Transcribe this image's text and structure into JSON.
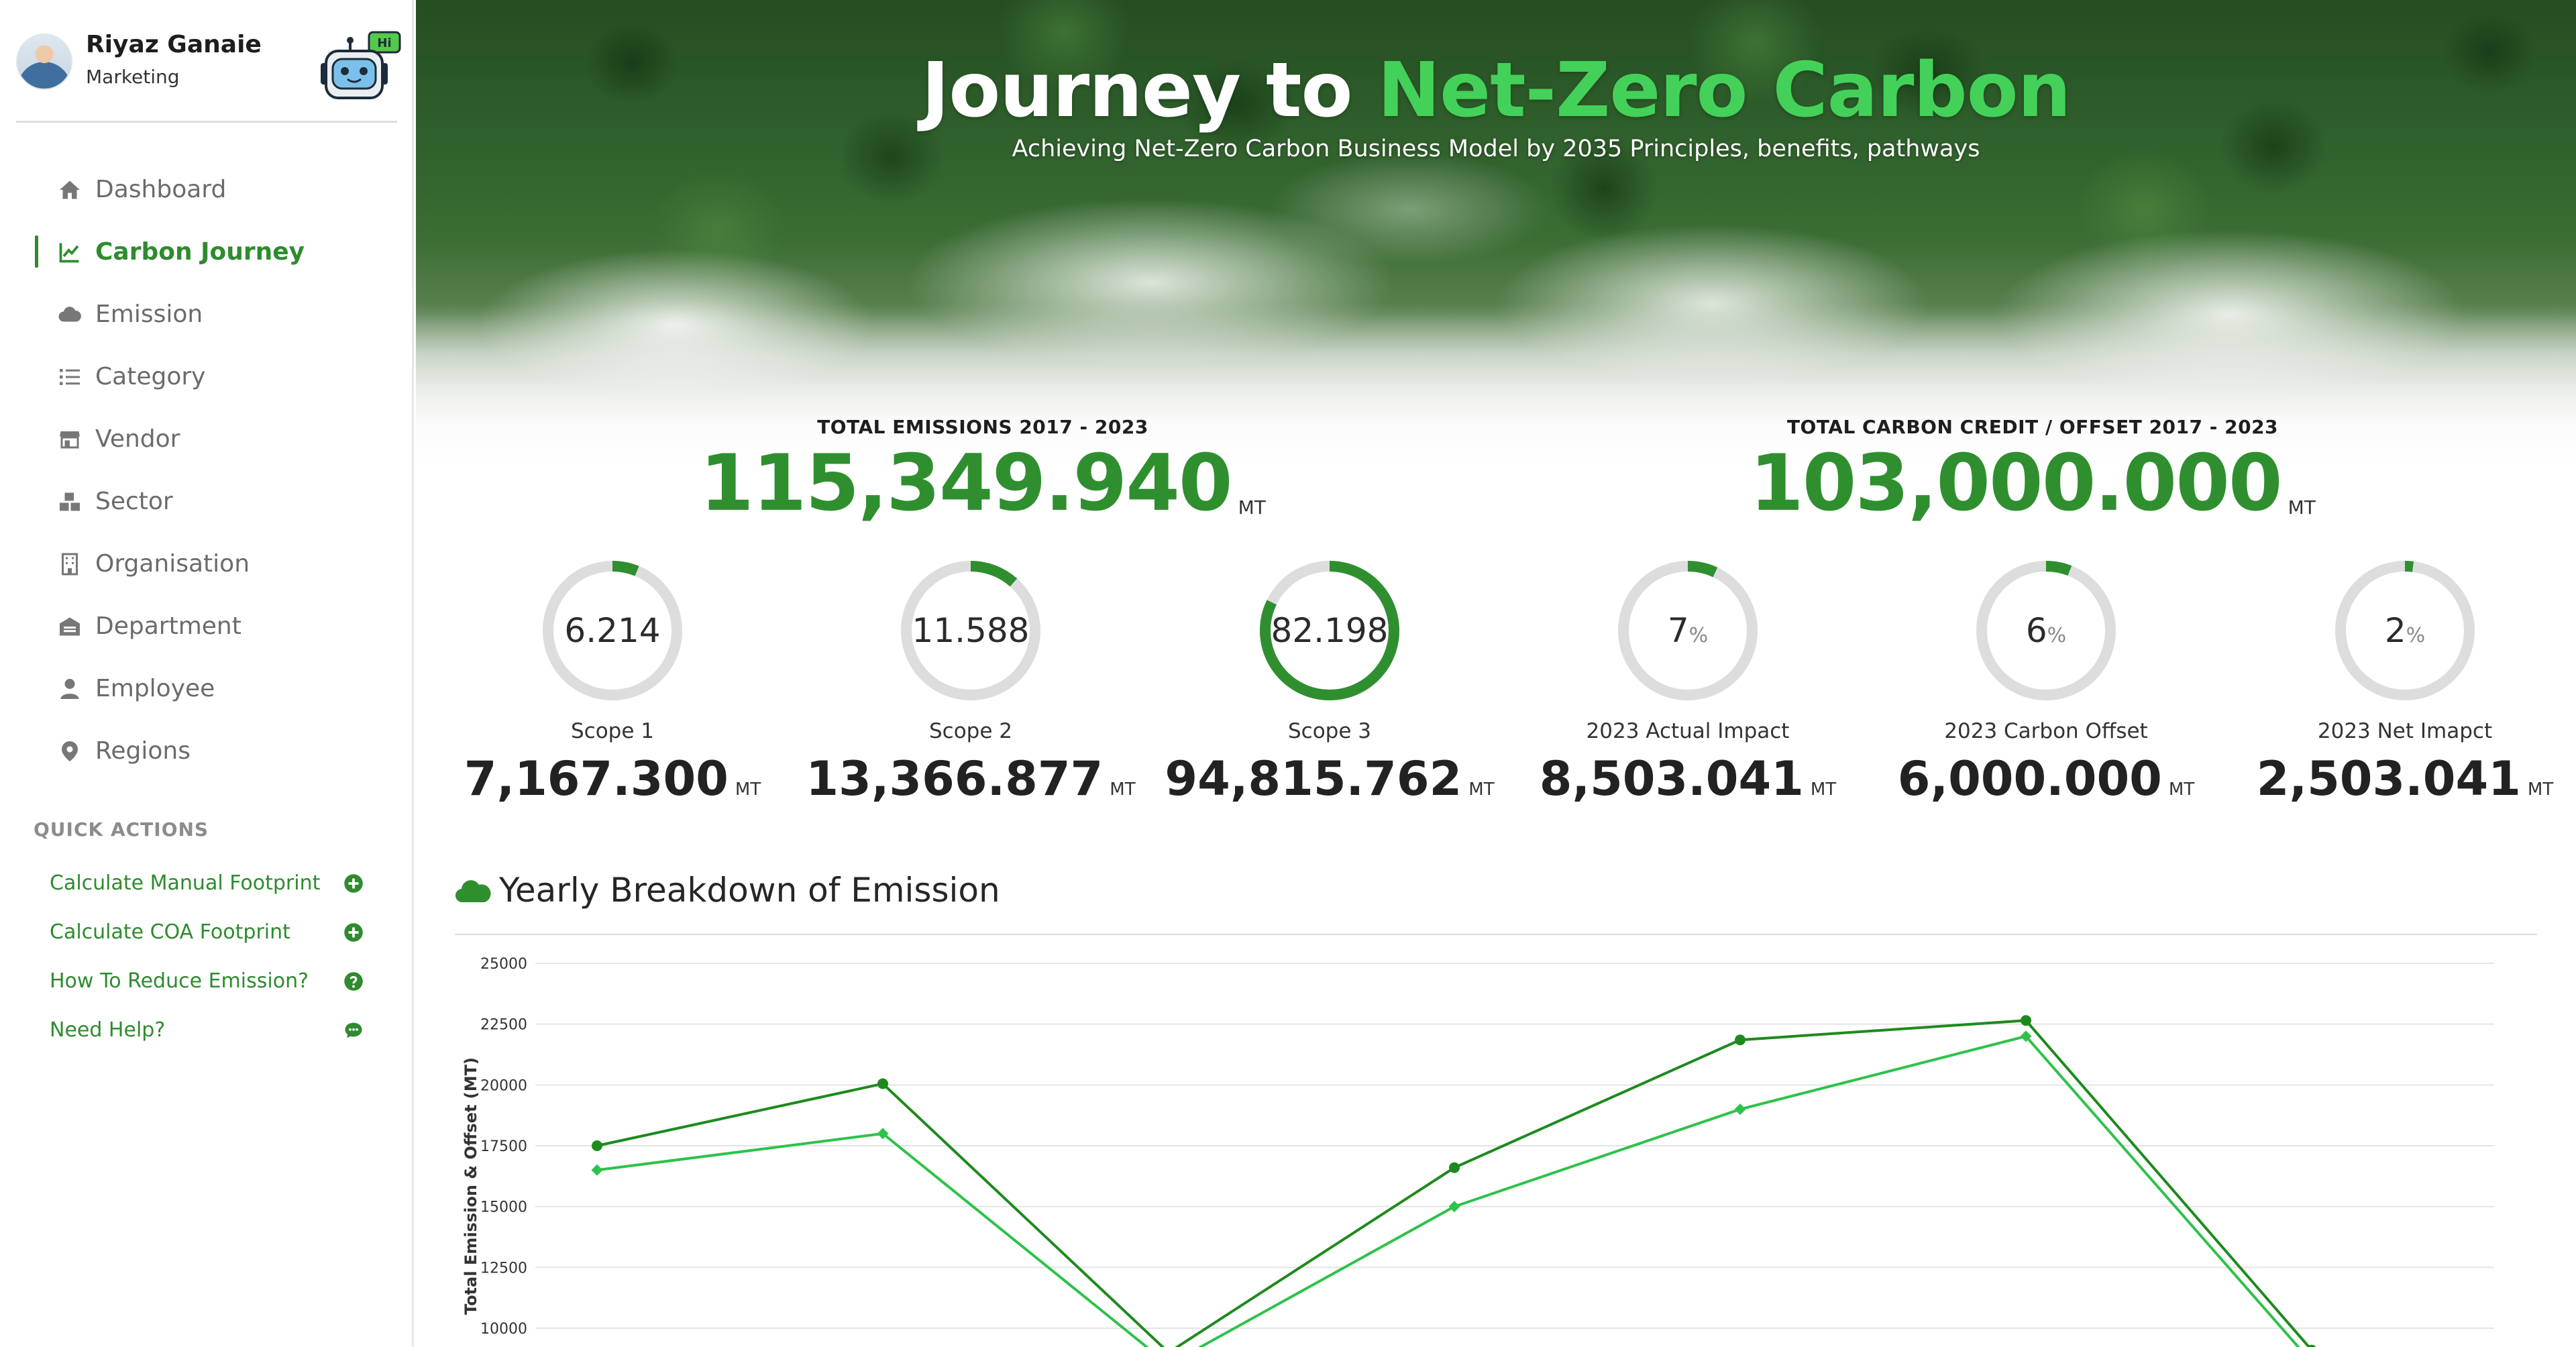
{
  "user": {
    "name": "Riyaz Ganaie",
    "role": "Marketing",
    "bot_badge": "Hi"
  },
  "nav": {
    "items": [
      {
        "label": "Dashboard",
        "icon": "home-icon",
        "active": false
      },
      {
        "label": "Carbon Journey",
        "icon": "line-chart-icon",
        "active": true
      },
      {
        "label": "Emission",
        "icon": "cloud-icon",
        "active": false
      },
      {
        "label": "Category",
        "icon": "list-icon",
        "active": false
      },
      {
        "label": "Vendor",
        "icon": "store-icon",
        "active": false
      },
      {
        "label": "Sector",
        "icon": "boxes-icon",
        "active": false
      },
      {
        "label": "Organisation",
        "icon": "building-icon",
        "active": false
      },
      {
        "label": "Department",
        "icon": "warehouse-icon",
        "active": false
      },
      {
        "label": "Employee",
        "icon": "user-icon",
        "active": false
      },
      {
        "label": "Regions",
        "icon": "map-pin-icon",
        "active": false
      }
    ]
  },
  "quick_actions": {
    "title": "QUICK ACTIONS",
    "items": [
      {
        "label": "Calculate Manual Footprint",
        "icon": "plus-circle-icon"
      },
      {
        "label": "Calculate COA Footprint",
        "icon": "plus-circle-icon"
      },
      {
        "label": "How To Reduce Emission?",
        "icon": "question-circle-icon"
      },
      {
        "label": "Need Help?",
        "icon": "chat-bubble-icon"
      }
    ]
  },
  "hero": {
    "title_prefix": "Journey to ",
    "title_accent": "Net-Zero Carbon",
    "subtitle": "Achieving Net-Zero Carbon Business Model by 2035 Principles, benefits, pathways"
  },
  "totals": {
    "emissions": {
      "label": "TOTAL EMISSIONS 2017 - 2023",
      "value": "115,349.940",
      "unit": "MT"
    },
    "credit": {
      "label": "TOTAL CARBON CREDIT / OFFSET 2017 - 2023",
      "value": "103,000.000",
      "unit": "MT"
    }
  },
  "stats": [
    {
      "gauge_text": "6.214",
      "pct_suffix": "",
      "percent": 6.214,
      "label": "Scope 1",
      "value": "7,167.300",
      "unit": "MT"
    },
    {
      "gauge_text": "11.588",
      "pct_suffix": "",
      "percent": 11.588,
      "label": "Scope 2",
      "value": "13,366.877",
      "unit": "MT"
    },
    {
      "gauge_text": "82.198",
      "pct_suffix": "",
      "percent": 82.198,
      "label": "Scope 3",
      "value": "94,815.762",
      "unit": "MT"
    },
    {
      "gauge_text": "7",
      "pct_suffix": "%",
      "percent": 7,
      "label": "2023 Actual Impact",
      "value": "8,503.041",
      "unit": "MT"
    },
    {
      "gauge_text": "6",
      "pct_suffix": "%",
      "percent": 6,
      "label": "2023 Carbon Offset",
      "value": "6,000.000",
      "unit": "MT"
    },
    {
      "gauge_text": "2",
      "pct_suffix": "%",
      "percent": 2,
      "label": "2023 Net Imapct",
      "value": "2,503.041",
      "unit": "MT"
    }
  ],
  "colors": {
    "accent": "#2f8f2f",
    "accent_light": "#43d15a",
    "track": "#dddddd",
    "line_dark": "#1e8a1e",
    "line_light": "#2ec24a"
  },
  "chart": {
    "title": "Yearly Breakdown of Emission",
    "icon": "cloud-icon"
  },
  "chart_data": {
    "type": "line",
    "title": "Yearly Breakdown of Emission",
    "xlabel": "",
    "ylabel": "Total Emission & Offset (MT)",
    "y_ticks": [
      10000,
      12500,
      15000,
      17500,
      20000,
      22500,
      25000
    ],
    "ylim": [
      10000,
      25000
    ],
    "grid": true,
    "legend": "none",
    "x_count": 7,
    "series": [
      {
        "color": "#1e8a1e",
        "values": [
          17500,
          20050,
          9000,
          16600,
          21850,
          22650,
          9100
        ]
      },
      {
        "color": "#2ec24a",
        "values": [
          16500,
          18000,
          8500,
          15000,
          19000,
          22000,
          8600
        ]
      }
    ]
  }
}
